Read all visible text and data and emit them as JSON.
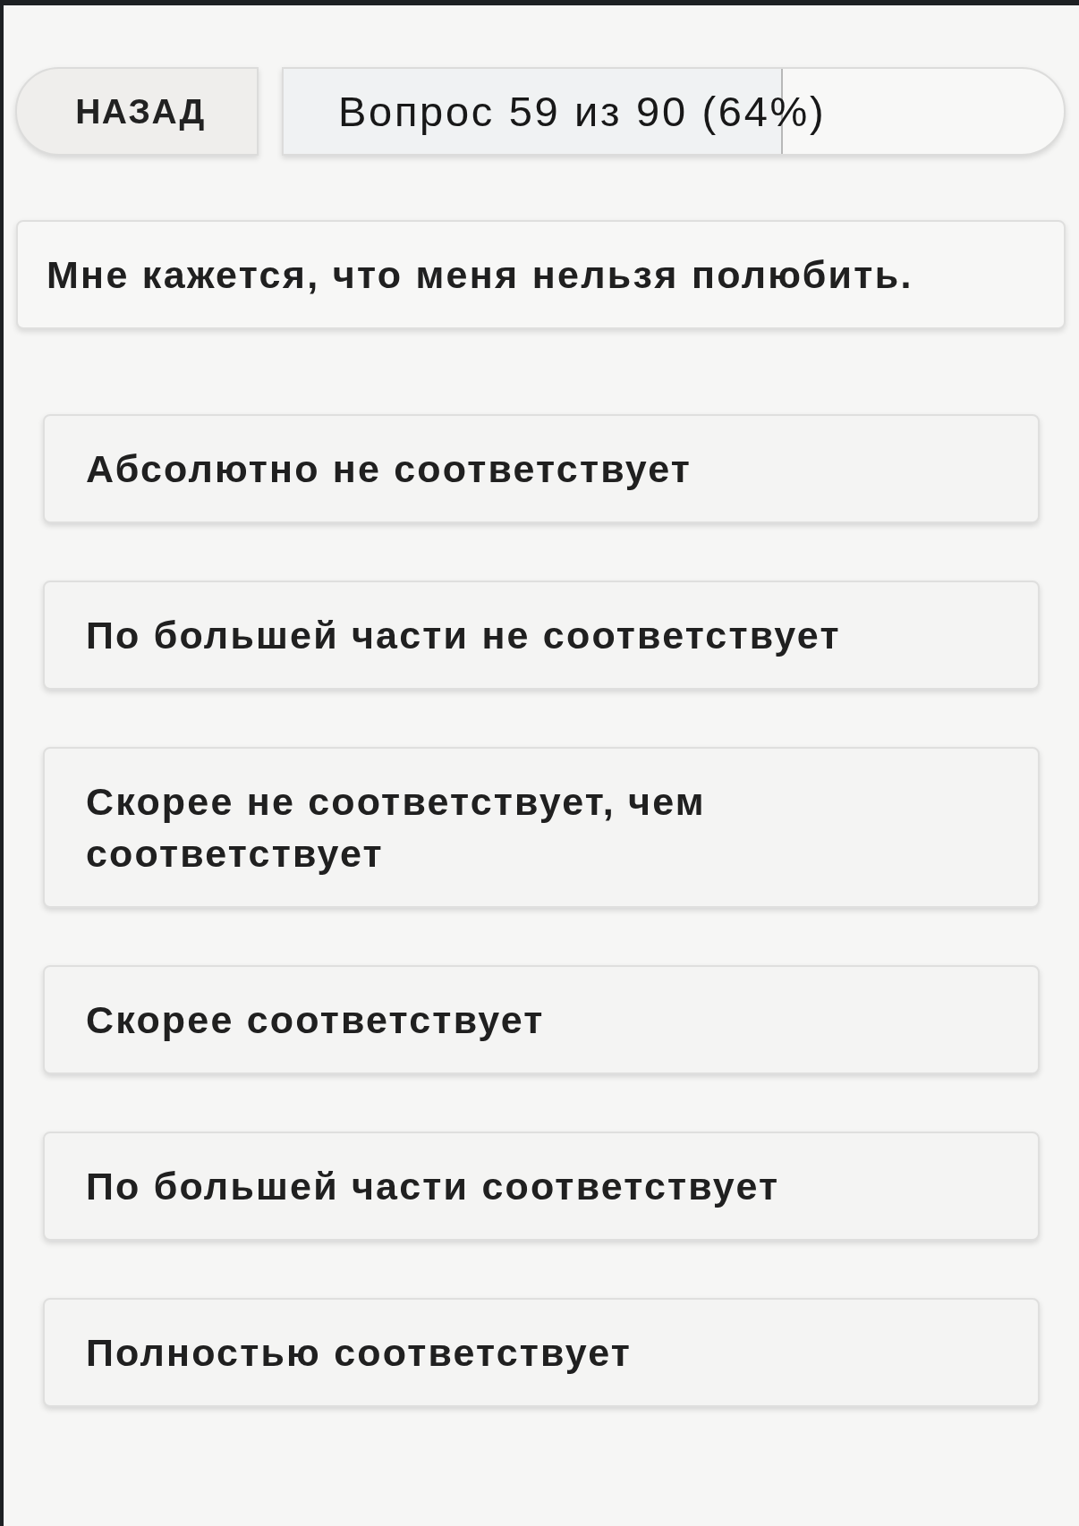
{
  "header": {
    "back_button": "НАЗАД",
    "progress": {
      "label": "Вопрос 59 из 90 (64%)",
      "level": 0.64
    }
  },
  "question": "Мне кажется, что меня нельзя полюбить.",
  "options": [
    {
      "label": "Абсолютно не соответствует",
      "selected": false
    },
    {
      "label": "По большей части не соответствует",
      "selected": false
    },
    {
      "label": "Скорее не соответствует, чем соответствует",
      "selected": false
    },
    {
      "label": "Скорее соответствует",
      "selected": false
    },
    {
      "label": "По большей части соответствует",
      "selected": false
    },
    {
      "label": "Полностью соответствует",
      "selected": false
    }
  ]
}
